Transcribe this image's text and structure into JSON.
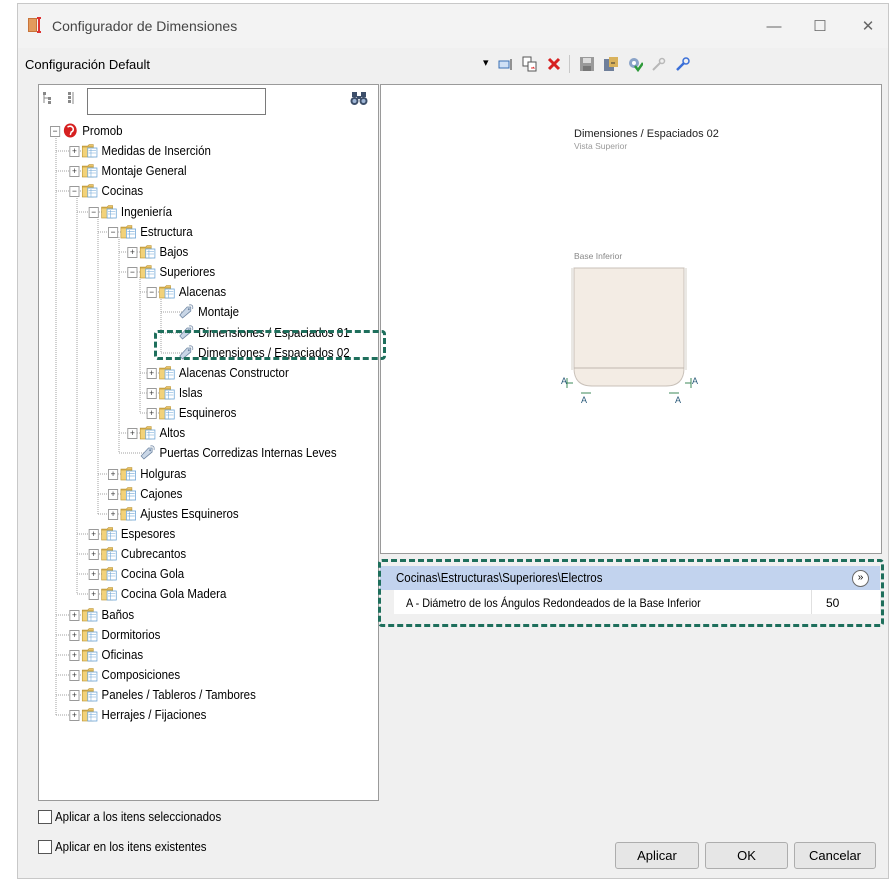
{
  "window": {
    "title": "Configurador de Dimensiones",
    "minimize": "—",
    "maximize": "☐",
    "close": "✕"
  },
  "config": {
    "name": "Configuración Default",
    "dropdown_arrow": "▾"
  },
  "toolbar_icons": [
    "rename-icon",
    "copy-icon",
    "delete-icon",
    "save-icon",
    "export-icon",
    "settings-icon",
    "link-icon",
    "pin-icon"
  ],
  "tree": {
    "search_value": "",
    "search_icon": "binoculars-icon",
    "nodes": [
      {
        "label": "Promob",
        "level": 0,
        "expander": "minus",
        "icon": "promob"
      },
      {
        "label": "Medidas de Inserción",
        "level": 1,
        "expander": "plus",
        "icon": "folder"
      },
      {
        "label": "Montaje General",
        "level": 1,
        "expander": "plus",
        "icon": "folder"
      },
      {
        "label": "Cocinas",
        "level": 1,
        "expander": "minus",
        "icon": "folder"
      },
      {
        "label": "Ingeniería",
        "level": 2,
        "expander": "minus",
        "icon": "folder"
      },
      {
        "label": "Estructura",
        "level": 3,
        "expander": "minus",
        "icon": "folder"
      },
      {
        "label": "Bajos",
        "level": 4,
        "expander": "plus",
        "icon": "folder"
      },
      {
        "label": "Superiores",
        "level": 4,
        "expander": "minus",
        "icon": "folder"
      },
      {
        "label": "Alacenas",
        "level": 5,
        "expander": "minus",
        "icon": "folder"
      },
      {
        "label": "Montaje",
        "level": 6,
        "expander": "none",
        "icon": "tag"
      },
      {
        "label": "Dimensiones / Espaciados 01",
        "level": 6,
        "expander": "none",
        "icon": "tag"
      },
      {
        "label": "Dimensiones / Espaciados 02",
        "level": 6,
        "expander": "none",
        "icon": "tag"
      },
      {
        "label": "Alacenas Constructor",
        "level": 5,
        "expander": "plus",
        "icon": "folder"
      },
      {
        "label": "Islas",
        "level": 5,
        "expander": "plus",
        "icon": "folder"
      },
      {
        "label": "Esquineros",
        "level": 5,
        "expander": "plus",
        "icon": "folder"
      },
      {
        "label": "Altos",
        "level": 4,
        "expander": "plus",
        "icon": "folder"
      },
      {
        "label": "Puertas Corredizas Internas Leves",
        "level": 4,
        "expander": "none",
        "icon": "tag"
      },
      {
        "label": "Holguras",
        "level": 3,
        "expander": "plus",
        "icon": "folder"
      },
      {
        "label": "Cajones",
        "level": 3,
        "expander": "plus",
        "icon": "folder"
      },
      {
        "label": "Ajustes Esquineros",
        "level": 3,
        "expander": "plus",
        "icon": "folder"
      },
      {
        "label": "Espesores",
        "level": 2,
        "expander": "plus",
        "icon": "folder"
      },
      {
        "label": "Cubrecantos",
        "level": 2,
        "expander": "plus",
        "icon": "folder"
      },
      {
        "label": "Cocina Gola",
        "level": 2,
        "expander": "plus",
        "icon": "folder"
      },
      {
        "label": "Cocina Gola Madera",
        "level": 2,
        "expander": "plus",
        "icon": "folder"
      },
      {
        "label": "Baños",
        "level": 1,
        "expander": "plus",
        "icon": "folder"
      },
      {
        "label": "Dormitorios",
        "level": 1,
        "expander": "plus",
        "icon": "folder"
      },
      {
        "label": "Oficinas",
        "level": 1,
        "expander": "plus",
        "icon": "folder"
      },
      {
        "label": "Composiciones",
        "level": 1,
        "expander": "plus",
        "icon": "folder"
      },
      {
        "label": "Paneles / Tableros / Tambores",
        "level": 1,
        "expander": "plus",
        "icon": "folder"
      },
      {
        "label": "Herrajes / Fijaciones",
        "level": 1,
        "expander": "plus",
        "icon": "folder"
      }
    ]
  },
  "preview": {
    "title": "Dimensiones / Espaciados 02",
    "subtitle": "Vista Superior",
    "part_label": "Base Inferior",
    "dim_letter": "A"
  },
  "properties": {
    "path": "Cocinas\\Estructuras\\Superiores\\Electros",
    "collapse_icon": "collapse-up-icon",
    "rows": [
      {
        "name": "A - Diámetro de los Ángulos Redondeados de la Base Inferior",
        "value": "50"
      }
    ]
  },
  "options": {
    "apply_selected": "Aplicar a los itens seleccionados",
    "apply_existing": "Aplicar en los itens existentes"
  },
  "buttons": {
    "apply": "Aplicar",
    "ok": "OK",
    "cancel": "Cancelar"
  }
}
